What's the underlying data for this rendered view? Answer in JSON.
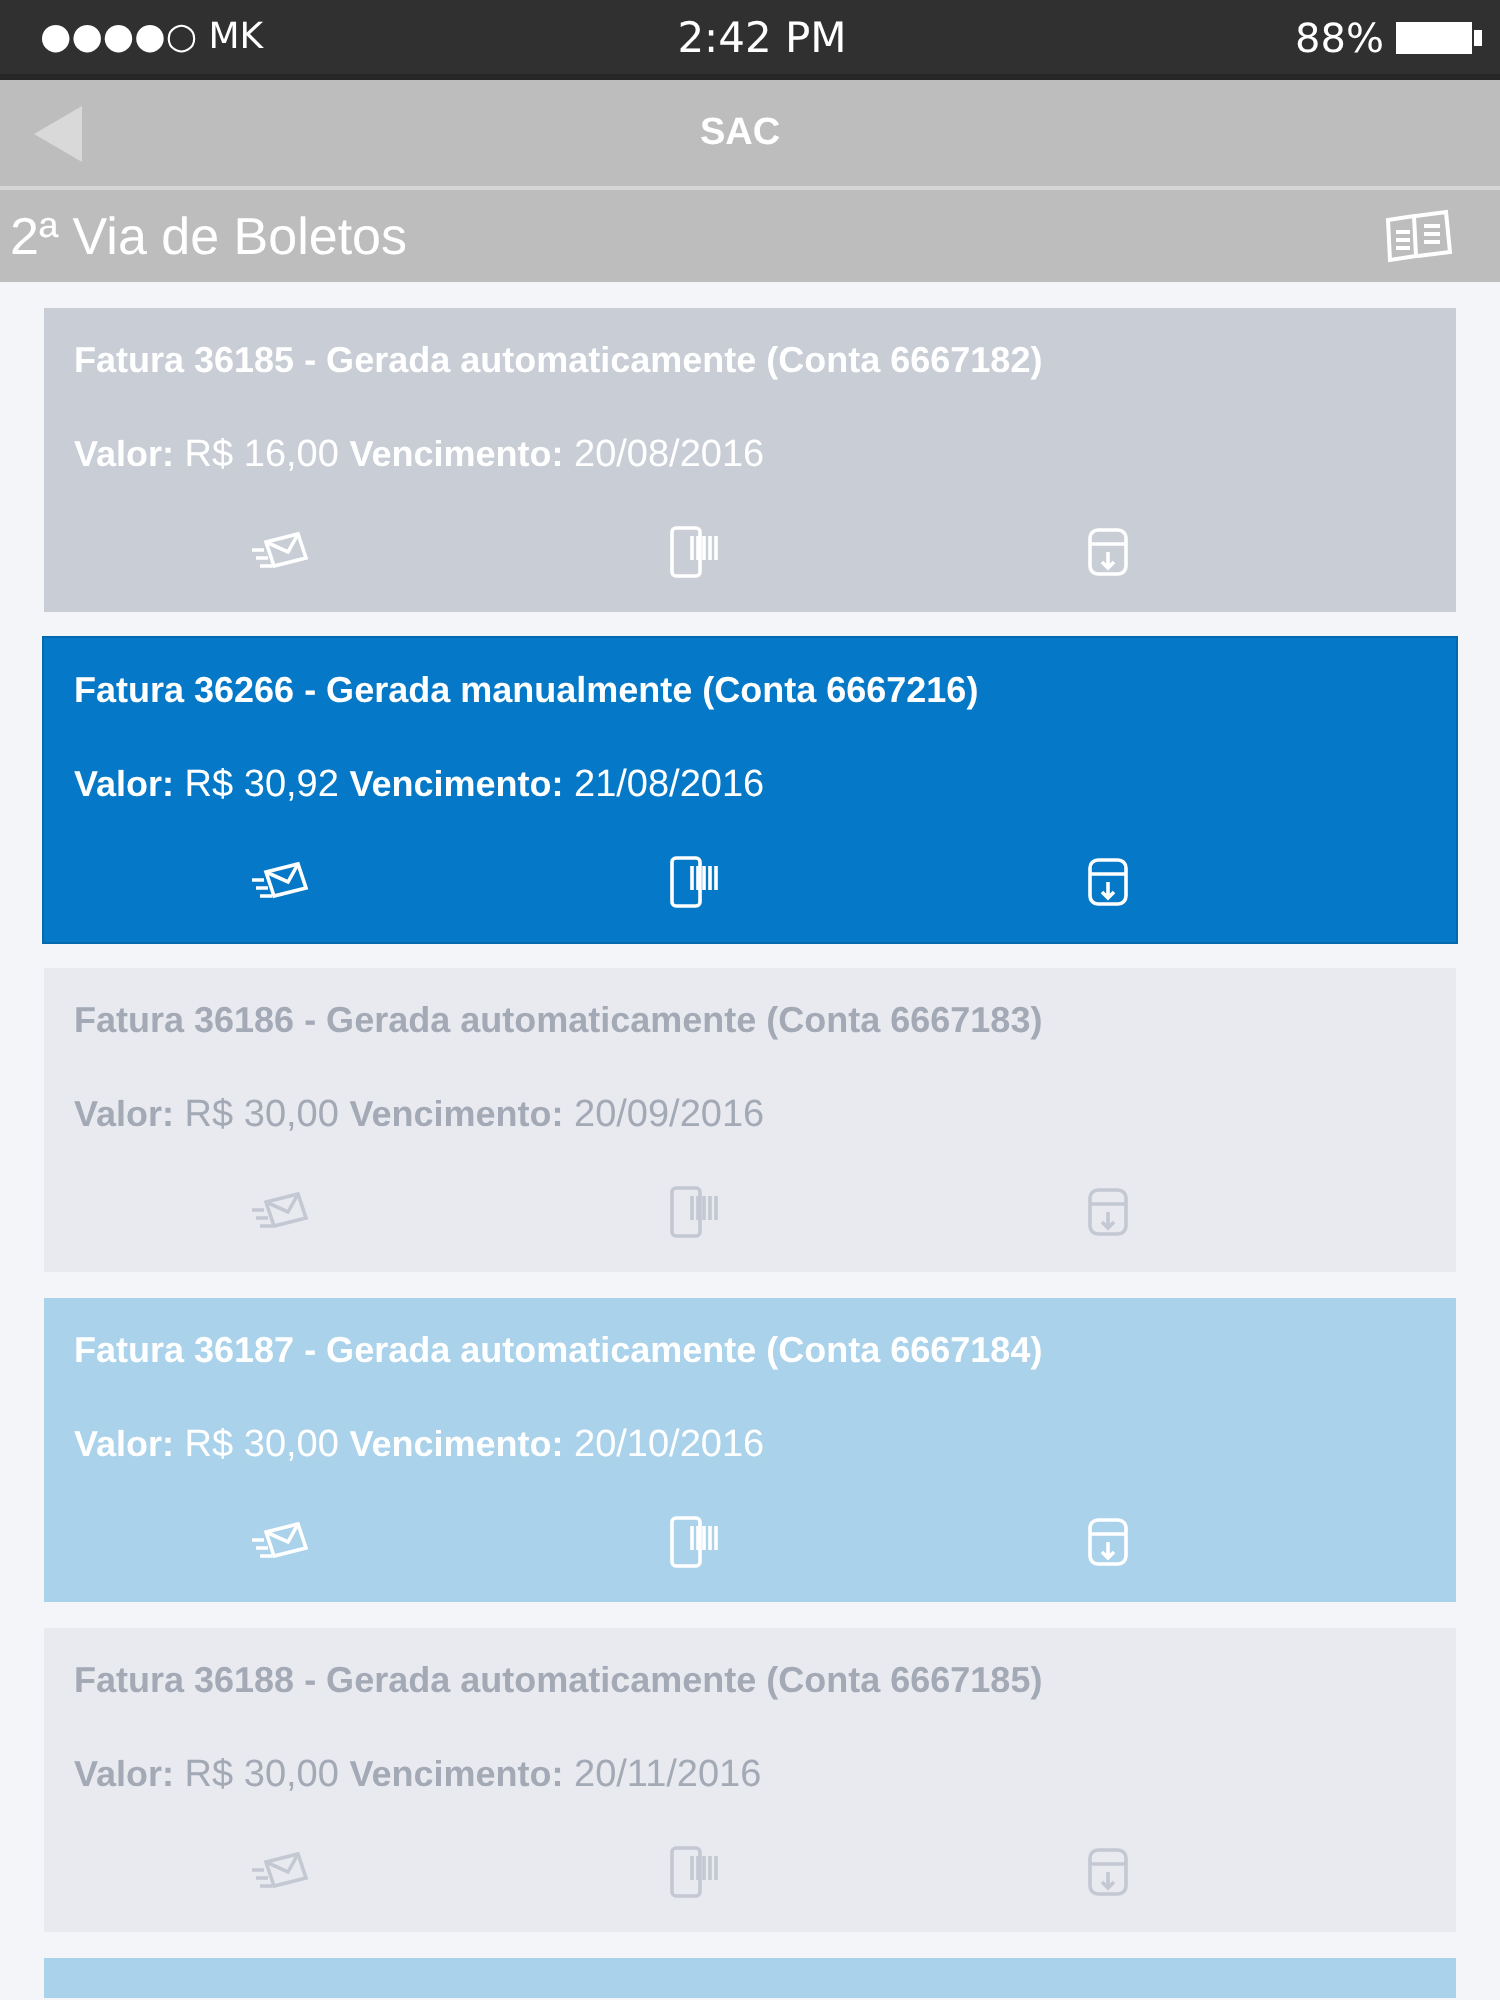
{
  "status_bar": {
    "carrier": "●●●●○ MK",
    "time": "2:42 PM",
    "battery": "88%"
  },
  "nav_bar": {
    "title": "SAC"
  },
  "page": {
    "title": "2ª Via de Boletos"
  },
  "invoices": [
    {
      "title": "Fatura 36185 - Gerada automaticamente (Conta 6667182)",
      "details": "**Valor:** R$ 16,00 **Vencimento:** 20/08/2016",
      "color": "#c8cdd6",
      "selected": false,
      "disabled": false
    },
    {
      "title": "Fatura 36266 - Gerada manualmente (Conta 6667216)",
      "details": "**Valor:** R$ 30,92 **Vencimento:** 21/08/2016",
      "color": "#0a78c2",
      "selected": true,
      "disabled": false
    },
    {
      "title": "Fatura 36186 - Gerada automaticamente (Conta 6667183)",
      "details": "**Valor:** R$ 30,00 **Vencimento:** 20/09/2016",
      "color": "#e8eaf0",
      "selected": false,
      "disabled": true
    },
    {
      "title": "Fatura 36187 - Gerada automaticamente (Conta 6667184)",
      "details": "**Valor:** R$ 30,00 **Vencimento:** 20/10/2016",
      "color": "#aad2ea",
      "selected": false,
      "disabled": false
    },
    {
      "title": "Fatura 36188 - Gerada automaticamente (Conta 6667185)",
      "details": "**Valor:** R$ 30,00 **Vencimento:** 20/11/2016",
      "color": "#e8eaf0",
      "selected": false,
      "disabled": true
    },
    {
      "kind": "cut",
      "color": "#aad2ea",
      "selected": false
    }
  ]
}
